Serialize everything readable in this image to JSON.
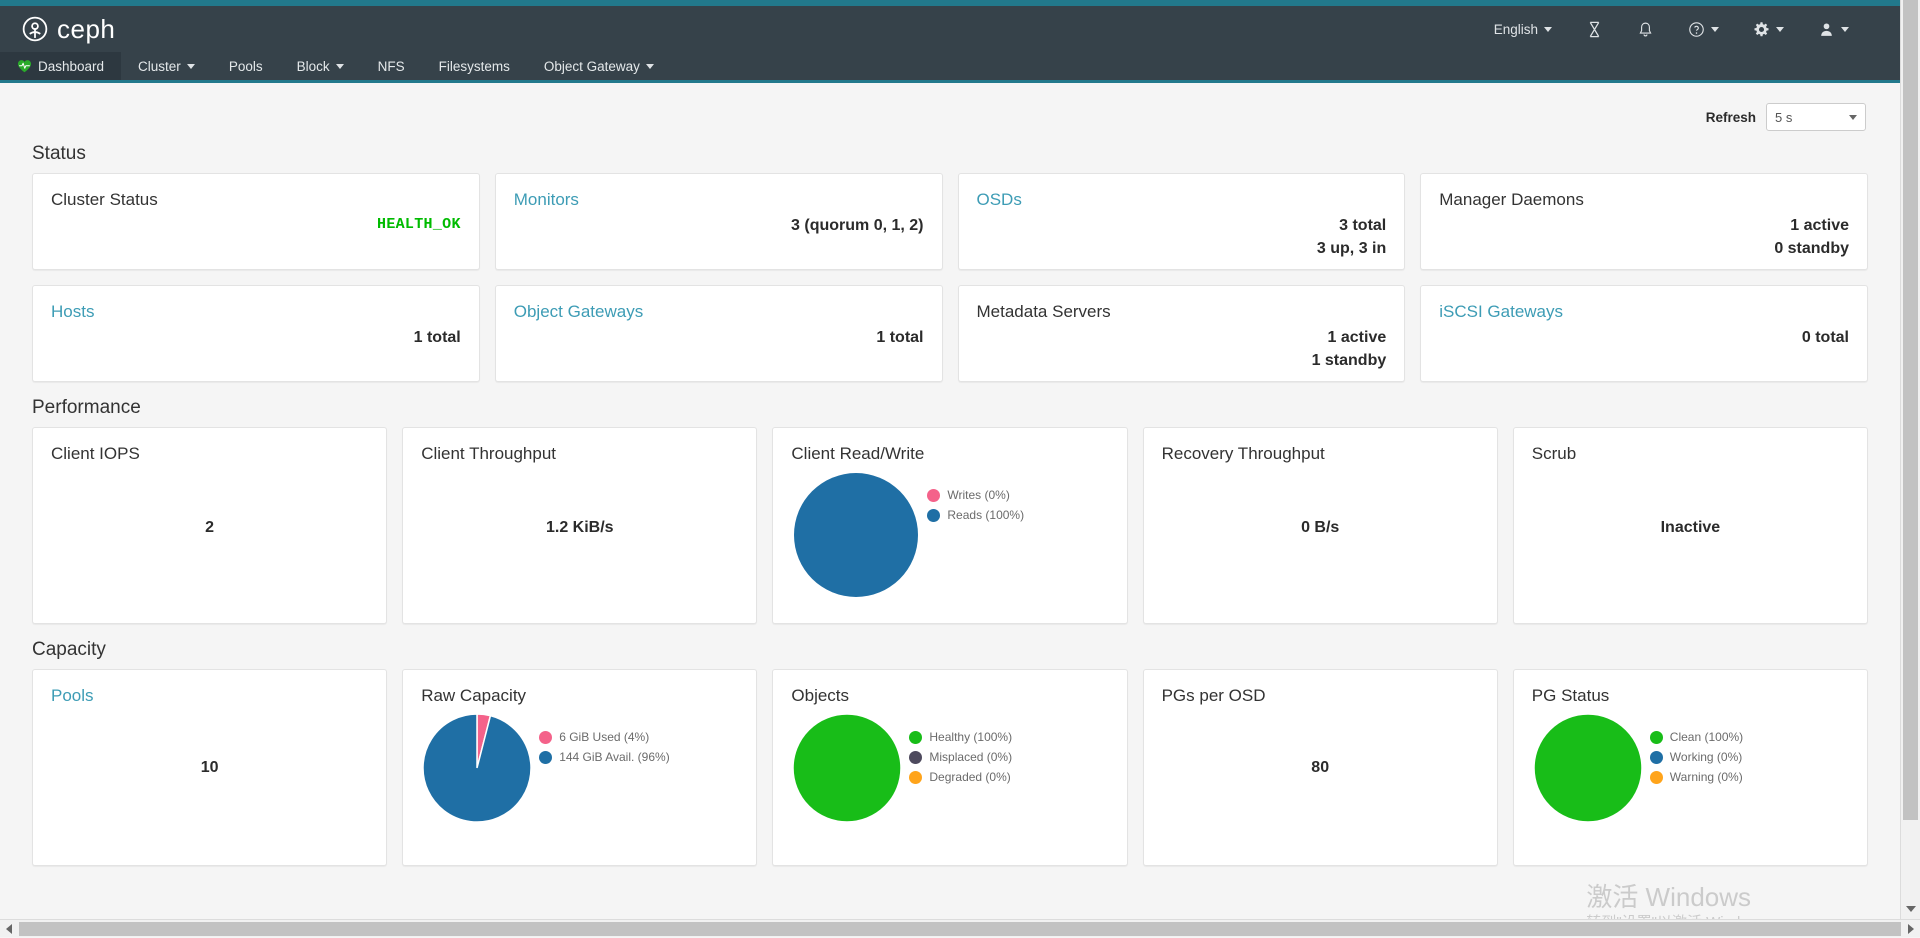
{
  "brand": {
    "name": "ceph",
    "logo_icon": "ceph-logo-icon"
  },
  "topbar": {
    "language": "English",
    "icons": [
      {
        "name": "tasks-icon",
        "glyph": "hourglass"
      },
      {
        "name": "notifications-icon",
        "glyph": "bell"
      },
      {
        "name": "help-icon",
        "glyph": "question-circle"
      },
      {
        "name": "settings-icon",
        "glyph": "gear"
      },
      {
        "name": "user-icon",
        "glyph": "user"
      }
    ]
  },
  "nav": {
    "items": [
      {
        "label": "Dashboard",
        "active": true,
        "icon": "heartbeat-icon",
        "has_caret": false
      },
      {
        "label": "Cluster",
        "active": false,
        "has_caret": true
      },
      {
        "label": "Pools",
        "active": false,
        "has_caret": false
      },
      {
        "label": "Block",
        "active": false,
        "has_caret": true
      },
      {
        "label": "NFS",
        "active": false,
        "has_caret": false
      },
      {
        "label": "Filesystems",
        "active": false,
        "has_caret": false
      },
      {
        "label": "Object Gateway",
        "active": false,
        "has_caret": true
      }
    ]
  },
  "refresh": {
    "label": "Refresh",
    "value": "5 s"
  },
  "sections": {
    "status": {
      "title": "Status"
    },
    "performance": {
      "title": "Performance"
    },
    "capacity": {
      "title": "Capacity"
    }
  },
  "status_cards": [
    {
      "title": "Cluster Status",
      "link": false,
      "value": "HEALTH_OK",
      "style": "health-ok"
    },
    {
      "title": "Monitors",
      "link": true,
      "value": "3 (quorum 0, 1, 2)"
    },
    {
      "title": "OSDs",
      "link": true,
      "value_line1": "3 total",
      "value_line2": "3 up, 3 in"
    },
    {
      "title": "Manager Daemons",
      "link": false,
      "value_line1": "1 active",
      "value_line2": "0 standby"
    },
    {
      "title": "Hosts",
      "link": true,
      "value": "1 total"
    },
    {
      "title": "Object Gateways",
      "link": true,
      "value": "1 total"
    },
    {
      "title": "Metadata Servers",
      "link": false,
      "value_line1": "1 active",
      "value_line2": "1 standby"
    },
    {
      "title": "iSCSI Gateways",
      "link": true,
      "value": "0 total"
    }
  ],
  "performance_cards": [
    {
      "title": "Client IOPS",
      "value": "2"
    },
    {
      "title": "Client Throughput",
      "value": "1.2 KiB/s"
    },
    {
      "title": "Client Read/Write",
      "chart": "client_read_write"
    },
    {
      "title": "Recovery Throughput",
      "value": "0 B/s"
    },
    {
      "title": "Scrub",
      "value": "Inactive"
    }
  ],
  "capacity_cards": [
    {
      "title": "Pools",
      "link": true,
      "value": "10"
    },
    {
      "title": "Raw Capacity",
      "link": false,
      "chart": "raw_capacity"
    },
    {
      "title": "Objects",
      "link": false,
      "chart": "objects"
    },
    {
      "title": "PGs per OSD",
      "link": false,
      "value": "80"
    },
    {
      "title": "PG Status",
      "link": false,
      "chart": "pg_status"
    }
  ],
  "chart_data": [
    {
      "id": "client_read_write",
      "type": "pie",
      "title": "Client Read/Write",
      "legend_position": "right",
      "labels": [
        "Writes (0%)",
        "Reads (100%)"
      ],
      "values": [
        0,
        100
      ],
      "colors": [
        "#f4628a",
        "#1f6fa5"
      ]
    },
    {
      "id": "raw_capacity",
      "type": "pie",
      "title": "Raw Capacity",
      "legend_position": "right",
      "labels": [
        "6 GiB Used (4%)",
        "144 GiB Avail. (96%)"
      ],
      "values": [
        4,
        96
      ],
      "colors": [
        "#f4628a",
        "#1f6fa5"
      ]
    },
    {
      "id": "objects",
      "type": "pie",
      "title": "Objects",
      "legend_position": "right",
      "labels": [
        "Healthy (100%)",
        "Misplaced (0%)",
        "Degraded (0%)"
      ],
      "values": [
        100,
        0,
        0
      ],
      "colors": [
        "#18bd18",
        "#4e4a5e",
        "#ffa41b"
      ]
    },
    {
      "id": "pg_status",
      "type": "pie",
      "title": "PG Status",
      "legend_position": "right",
      "labels": [
        "Clean (100%)",
        "Working (0%)",
        "Warning (0%)"
      ],
      "values": [
        100,
        0,
        0
      ],
      "colors": [
        "#18bd18",
        "#1f6fa5",
        "#ffa41b"
      ]
    }
  ],
  "watermark": {
    "line1": "激活 Windows",
    "line2": "转到\"设置\"以激活 Windows。"
  },
  "colors": {
    "brand_bar": "#36424a",
    "accent_teal": "#22798c",
    "link_blue": "#3d9cb5",
    "health_green": "#00bb00",
    "pie_blue": "#1f6fa5",
    "pie_pink": "#f4628a",
    "pie_green": "#18bd18",
    "pie_orange": "#ffa41b",
    "pie_purple": "#4e4a5e"
  }
}
